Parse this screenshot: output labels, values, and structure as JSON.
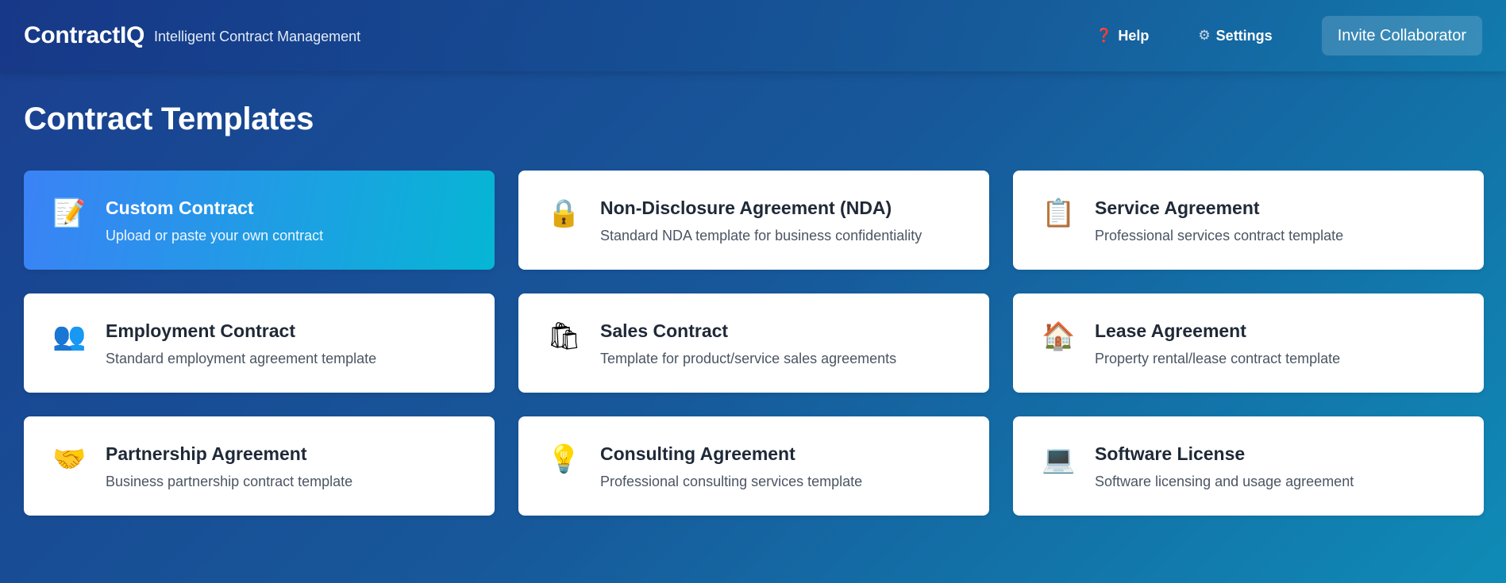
{
  "header": {
    "brand": "ContractIQ",
    "tagline": "Intelligent Contract Management",
    "help_label": "Help",
    "help_icon": "❓",
    "settings_label": "Settings",
    "settings_icon": "⚙",
    "invite_label": "Invite Collaborator"
  },
  "page": {
    "title": "Contract Templates"
  },
  "templates": [
    {
      "title": "Custom Contract",
      "desc": "Upload or paste your own contract",
      "icon": "📝",
      "icon_name": "memo-pencil-icon",
      "selected": true
    },
    {
      "title": "Non-Disclosure Agreement (NDA)",
      "desc": "Standard NDA template for business confidentiality",
      "icon": "🔒",
      "icon_name": "lock-icon"
    },
    {
      "title": "Service Agreement",
      "desc": "Professional services contract template",
      "icon": "📋",
      "icon_name": "clipboard-icon"
    },
    {
      "title": "Employment Contract",
      "desc": "Standard employment agreement template",
      "icon": "👥",
      "icon_name": "people-icon"
    },
    {
      "title": "Sales Contract",
      "desc": "Template for product/service sales agreements",
      "icon": "🛍",
      "icon_name": "shopping-bags-icon"
    },
    {
      "title": "Lease Agreement",
      "desc": "Property rental/lease contract template",
      "icon": "🏠",
      "icon_name": "house-icon"
    },
    {
      "title": "Partnership Agreement",
      "desc": "Business partnership contract template",
      "icon": "🤝",
      "icon_name": "handshake-icon"
    },
    {
      "title": "Consulting Agreement",
      "desc": "Professional consulting services template",
      "icon": "💡",
      "icon_name": "lightbulb-icon"
    },
    {
      "title": "Software License",
      "desc": "Software licensing and usage agreement",
      "icon": "💻",
      "icon_name": "laptop-icon"
    }
  ],
  "colors": {
    "selected_card_start": "#3b82f6",
    "selected_card_end": "#06b6d4"
  }
}
